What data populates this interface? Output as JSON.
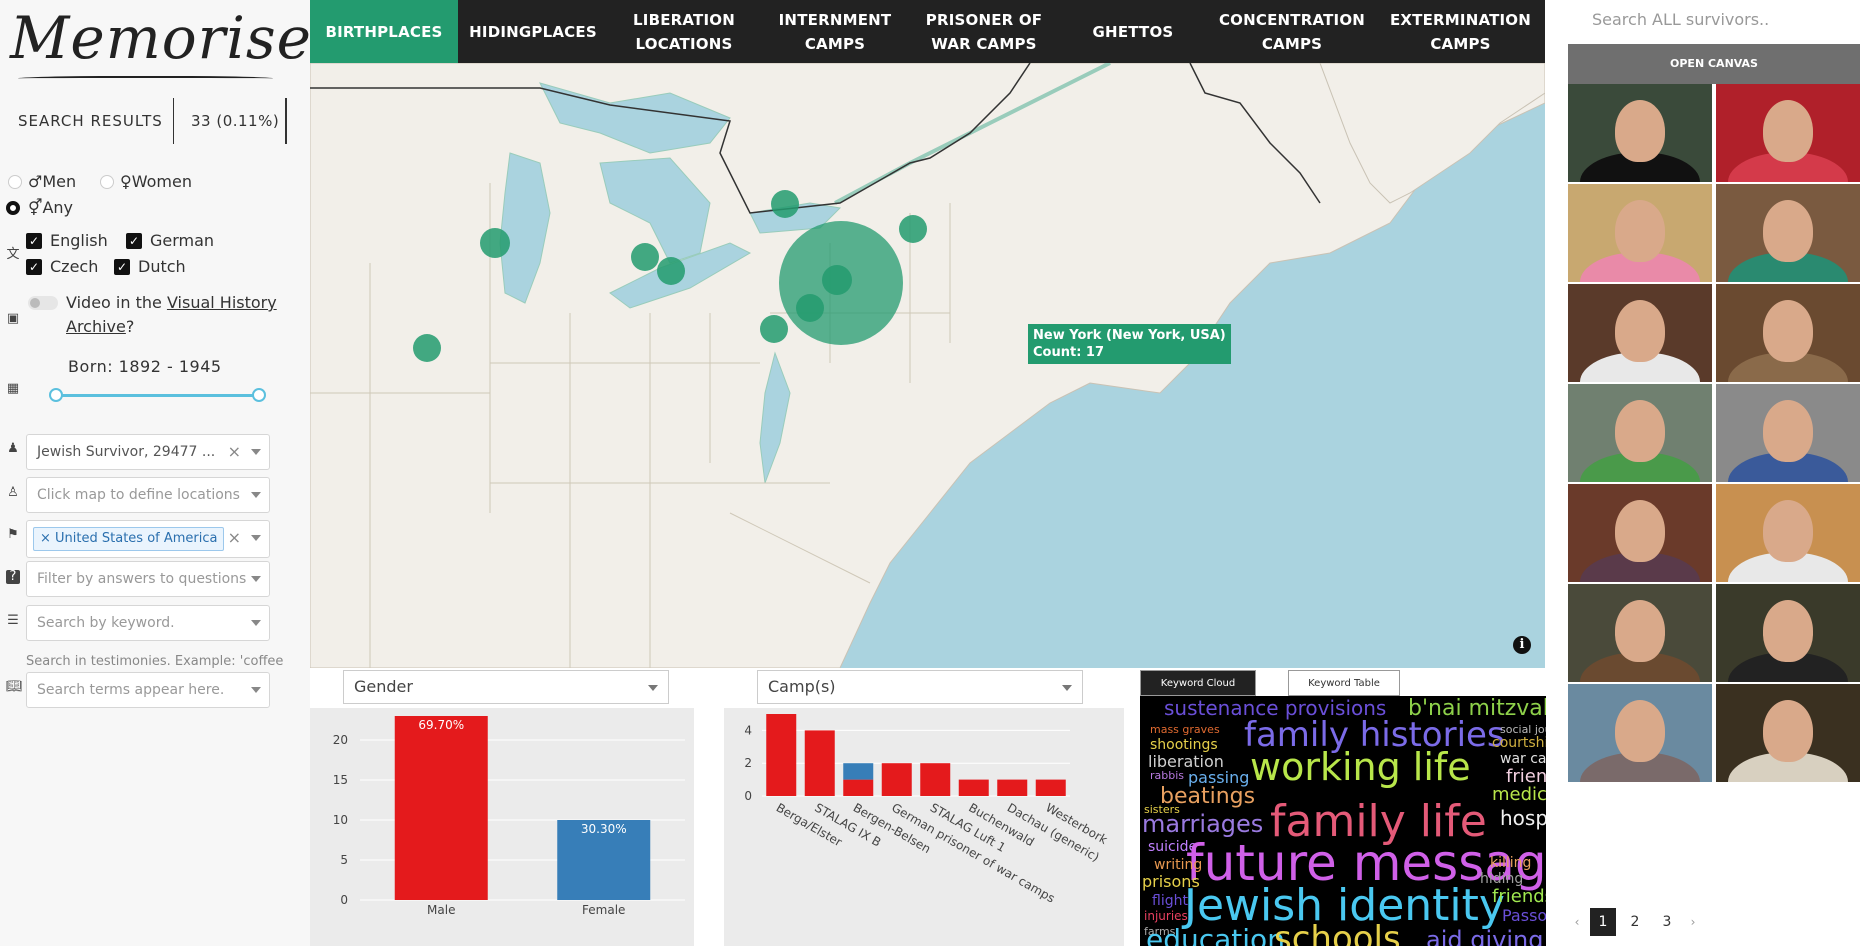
{
  "app": {
    "logo_text": "Memorise"
  },
  "results": {
    "label": "SEARCH RESULTS",
    "count": "33 (0.11%)"
  },
  "gender_filter": {
    "men": "♂Men",
    "women": "♀Women",
    "any": "⚥Any",
    "selected": "any"
  },
  "languages": [
    {
      "label": "English",
      "checked": true
    },
    {
      "label": "German",
      "checked": true
    },
    {
      "label": "Czech",
      "checked": true
    },
    {
      "label": "Dutch",
      "checked": true
    }
  ],
  "vha": {
    "prefix": "Video in the ",
    "link": "Visual History",
    "link2": "Archive",
    "suffix": "?"
  },
  "born": {
    "label": "Born: 1892 - 1945",
    "min": 1892,
    "max": 1945
  },
  "filters": {
    "survivor_type": "Jewish Survivor, 29477 ...",
    "locations_placeholder": "Click map to define locations",
    "country_tag": "United States of America",
    "questions_placeholder": "Filter by answers to questions",
    "keyword_placeholder": "Search by keyword.",
    "testimony_hint": "Search in testimonies. Example: 'coffee",
    "terms_placeholder": "Search terms appear here."
  },
  "nav": [
    {
      "label": "BIRTHPLACES",
      "active": true
    },
    {
      "label": "HIDINGPLACES",
      "active": false
    },
    {
      "label": "LIBERATION LOCATIONS",
      "active": false
    },
    {
      "label": "INTERNMENT CAMPS",
      "active": false
    },
    {
      "label": "PRISONER OF WAR CAMPS",
      "active": false
    },
    {
      "label": "GHETTOS",
      "active": false
    },
    {
      "label": "CONCENTRATION CAMPS",
      "active": false
    },
    {
      "label": "EXTERMINATION CAMPS",
      "active": false
    }
  ],
  "map": {
    "tooltip_line1": "New York (New York, USA)",
    "tooltip_line2": "Count: 17",
    "info_icon": "i"
  },
  "right": {
    "search_placeholder": "Search ALL survivors..",
    "open_canvas": "OPEN CANVAS",
    "thumb_count": 14,
    "pages": [
      "‹",
      "1",
      "2",
      "3",
      "›"
    ],
    "active_page": "1"
  },
  "gender_chart": {
    "dropdown": "Gender",
    "chart_data": {
      "type": "bar",
      "categories": [
        "Male",
        "Female"
      ],
      "values": [
        23,
        10
      ],
      "labels": [
        "69.70%",
        "30.30%"
      ],
      "colors": [
        "#e41a1c",
        "#377eb8"
      ],
      "yticks": [
        0,
        5,
        10,
        15,
        20
      ],
      "ylim": [
        0,
        23
      ]
    }
  },
  "camps_chart": {
    "dropdown": "Camp(s)",
    "chart_data": {
      "type": "bar",
      "categories": [
        "Berga/Elster",
        "STALAG IX B",
        "Bergen-Belsen",
        "German prisoner of war camps",
        "STALAG Luft 1",
        "Buchenwald",
        "Dachau (generic)",
        "Westerbork"
      ],
      "series": [
        {
          "values": [
            5,
            4,
            1,
            2,
            2,
            1,
            1,
            1
          ],
          "color": "#e41a1c"
        },
        {
          "values": [
            0,
            0,
            1,
            0,
            0,
            0,
            0,
            0
          ],
          "color": "#377eb8"
        }
      ],
      "yticks": [
        0,
        2,
        4
      ],
      "ylim": [
        0,
        5
      ]
    }
  },
  "keywords": {
    "tab_cloud": "Keyword Cloud",
    "tab_table": "Keyword Table"
  }
}
